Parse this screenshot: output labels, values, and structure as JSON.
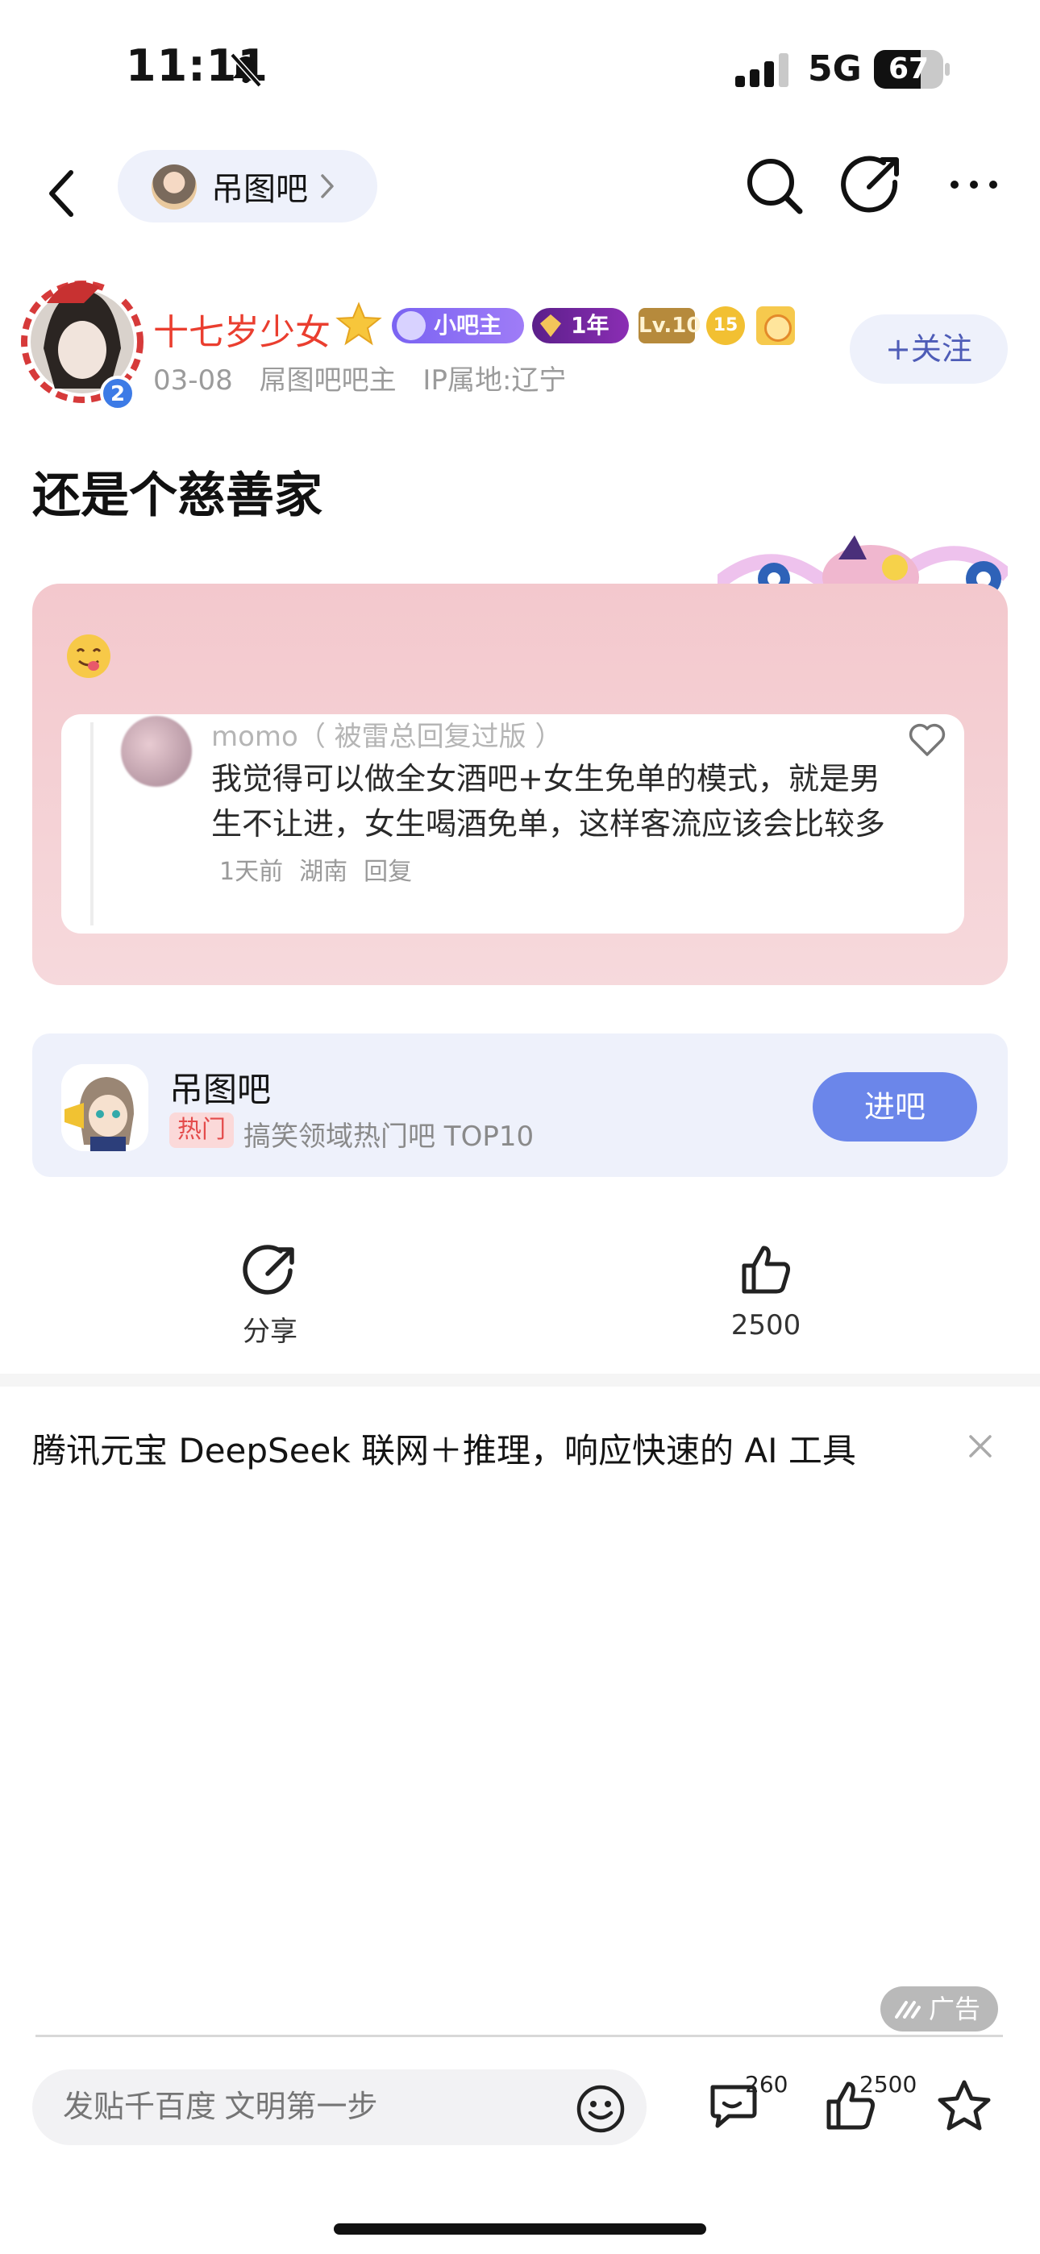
{
  "status_bar": {
    "time": "11:11",
    "network": "5G",
    "battery": "67",
    "battery_level": 0.67
  },
  "nav": {
    "forum_name": "吊图吧"
  },
  "author": {
    "name": "十七岁少女",
    "badges": {
      "moderator": "小吧主",
      "years": "1年",
      "level": "Lv.10",
      "round_badge": "15"
    },
    "date": "03-08",
    "role": "屌图吧吧主",
    "ip": "IP属地:辽宁",
    "avatar_badge": "2",
    "follow_label": "+关注"
  },
  "post": {
    "title": "还是个慈善家",
    "comment_screenshot": {
      "user": "momo（ 被雷总回复过版 ）",
      "text": "我觉得可以做全女酒吧+女生免单的模式，就是男生不让进，女生喝酒免单，这样客流应该会比较多",
      "time": "1天前",
      "location": "湖南",
      "reply": "回复"
    }
  },
  "forum_card": {
    "name": "吊图吧",
    "tag": "热门",
    "desc": "搞笑领域热门吧 TOP10",
    "enter_label": "进吧"
  },
  "actions": {
    "share_label": "分享",
    "like_count": "2500"
  },
  "ad": {
    "title": "腾讯元宝 DeepSeek 联网＋推理，响应快速的 AI 工具",
    "badge": "广告"
  },
  "bottom_bar": {
    "placeholder": "发贴千百度 文明第一步",
    "comment_count": "260",
    "like_count": "2500"
  },
  "colors": {
    "accent": "#6b86ea",
    "author_name": "#ea3e2f",
    "card_bg": "#eef1fb",
    "post_card": "#f3c8cd"
  },
  "icons": [
    "bell-slash-icon",
    "signal-icon",
    "battery-icon",
    "back-chevron-icon",
    "search-icon",
    "compose-icon",
    "more-icon",
    "star-icon",
    "heart-icon",
    "share-icon",
    "thumbs-up-icon",
    "close-icon",
    "emoji-icon",
    "comment-icon",
    "favorite-star-icon"
  ]
}
